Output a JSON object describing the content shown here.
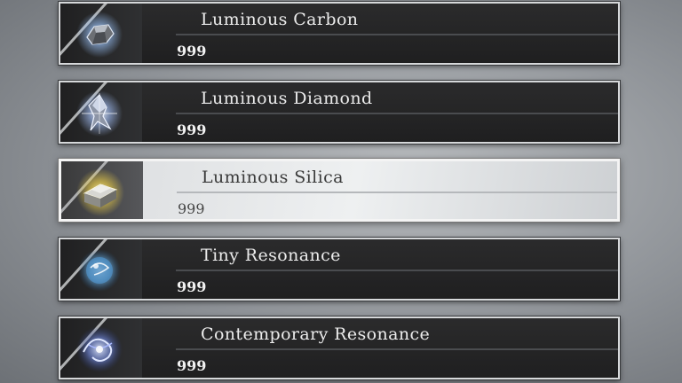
{
  "items": [
    {
      "name": "Luminous Carbon",
      "count": "999",
      "icon": "carbon-ore-icon",
      "glow": "#9fc8ff"
    },
    {
      "name": "Luminous Diamond",
      "count": "999",
      "icon": "diamond-crystal-icon",
      "glow": "#a9c6ff"
    },
    {
      "name": "Luminous Silica",
      "count": "999",
      "icon": "silica-ingot-icon",
      "glow": "#f0d24a"
    },
    {
      "name": "Tiny Resonance",
      "count": "999",
      "icon": "resonance-orb-icon",
      "glow": "#9ad0ff"
    },
    {
      "name": "Contemporary Resonance",
      "count": "999",
      "icon": "resonance-swirl-icon",
      "glow": "#8fb0ff"
    }
  ],
  "selected_index": 2
}
